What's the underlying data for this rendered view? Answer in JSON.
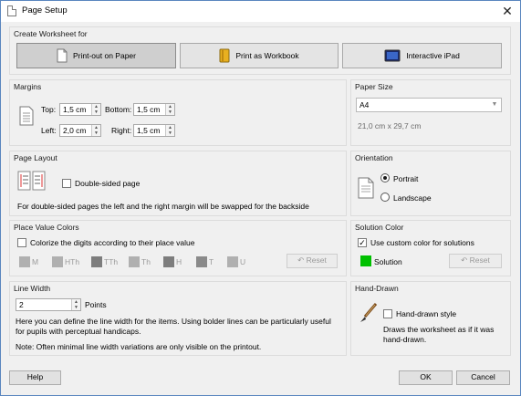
{
  "window": {
    "title": "Page Setup"
  },
  "worksheet": {
    "group_title": "Create Worksheet for",
    "buttons": [
      "Print-out on Paper",
      "Print as Workbook",
      "Interactive iPad"
    ]
  },
  "margins": {
    "group_title": "Margins",
    "top_label": "Top:",
    "top_value": "1,5 cm",
    "bottom_label": "Bottom:",
    "bottom_value": "1,5 cm",
    "left_label": "Left:",
    "left_value": "2,0 cm",
    "right_label": "Right:",
    "right_value": "1,5 cm"
  },
  "paper": {
    "group_title": "Paper Size",
    "selected": "A4",
    "dimensions": "21,0 cm x 29,7 cm"
  },
  "page_layout": {
    "group_title": "Page Layout",
    "double_sided_label": "Double-sided page",
    "double_sided_checked": false,
    "note": "For double-sided pages the left and the right margin will be swapped for the backside"
  },
  "orientation": {
    "group_title": "Orientation",
    "options": [
      "Portrait",
      "Landscape"
    ],
    "selected": "Portrait"
  },
  "place_value": {
    "group_title": "Place Value Colors",
    "colorize_label": "Colorize the digits according to their place value",
    "colorize_checked": false,
    "swatches": [
      "M",
      "HTh",
      "TTh",
      "Th",
      "H",
      "T",
      "U"
    ],
    "reset_label": "Reset"
  },
  "solution_color": {
    "group_title": "Solution Color",
    "custom_label": "Use custom color for solutions",
    "custom_checked": true,
    "swatch_label": "Solution",
    "swatch_color": "#00c000",
    "reset_label": "Reset"
  },
  "line_width": {
    "group_title": "Line Width",
    "value": "2",
    "unit": "Points",
    "description": "Here you can define the line width for the items. Using bolder lines can be particularly useful for pupils with perceptual handicaps.",
    "note": "Note: Often minimal line width variations are only visible on the printout."
  },
  "hand_drawn": {
    "group_title": "Hand-Drawn",
    "checkbox_label": "Hand-drawn style",
    "checked": false,
    "description": "Draws the worksheet as if it was hand-drawn."
  },
  "footer": {
    "help": "Help",
    "ok": "OK",
    "cancel": "Cancel"
  }
}
